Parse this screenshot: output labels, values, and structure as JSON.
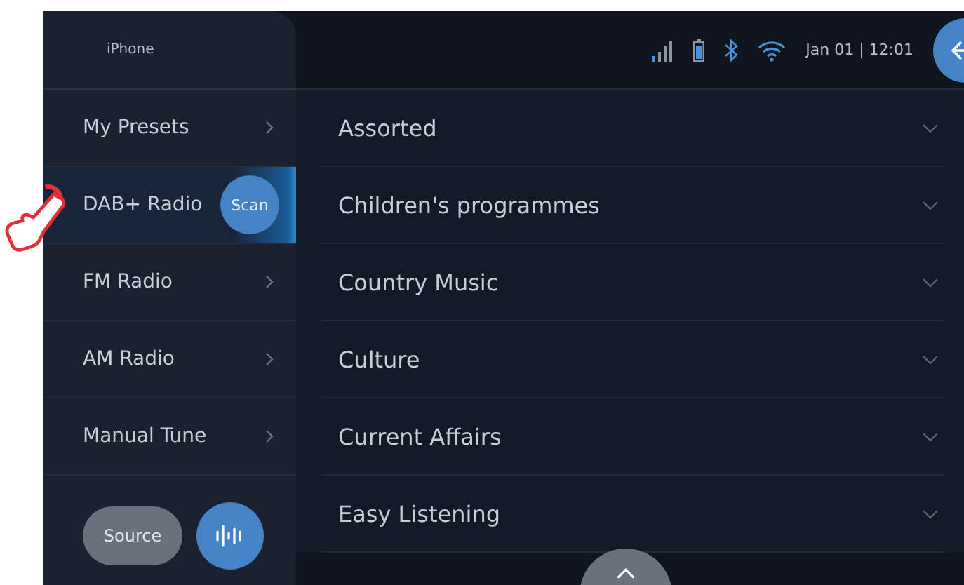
{
  "sidebar": {
    "device": "iPhone",
    "items": [
      {
        "label": "My Presets",
        "kind": "link",
        "selected": false
      },
      {
        "label": "DAB+ Radio",
        "kind": "scan",
        "action": "Scan",
        "selected": true
      },
      {
        "label": "FM Radio",
        "kind": "link",
        "selected": false
      },
      {
        "label": "AM Radio",
        "kind": "link",
        "selected": false
      },
      {
        "label": "Manual Tune",
        "kind": "link",
        "selected": false
      }
    ],
    "source_button": "Source"
  },
  "status_bar": {
    "datetime": "Jan 01 | 12:01"
  },
  "genres": [
    {
      "label": "Assorted"
    },
    {
      "label": "Children's programmes"
    },
    {
      "label": "Country Music"
    },
    {
      "label": "Culture"
    },
    {
      "label": "Current Affairs"
    },
    {
      "label": "Easy Listening"
    }
  ]
}
